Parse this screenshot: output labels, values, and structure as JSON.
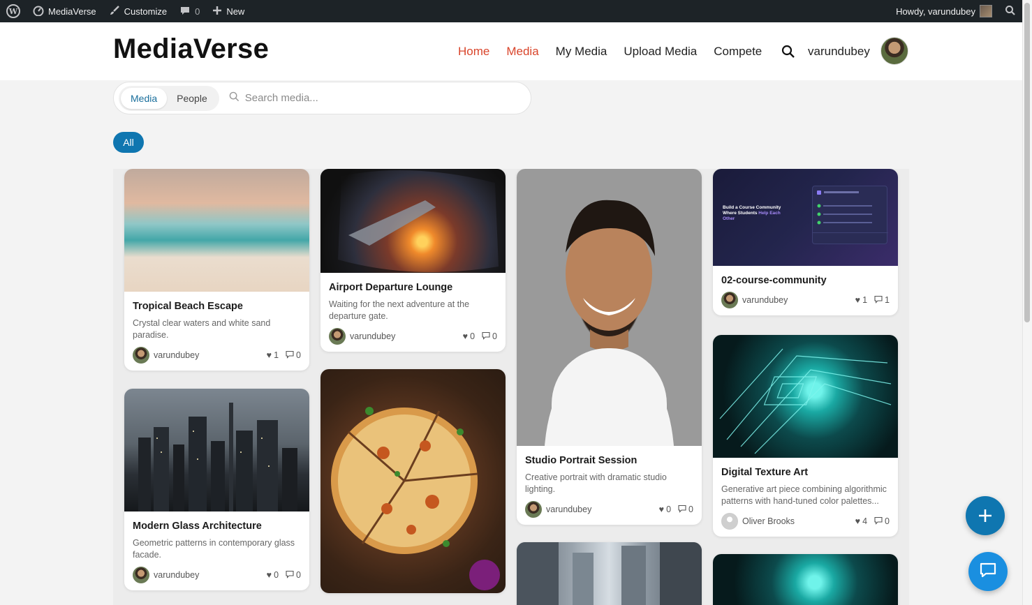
{
  "adminbar": {
    "site_name": "MediaVerse",
    "customize": "Customize",
    "comments_count": "0",
    "new_label": "New",
    "howdy": "Howdy, varundubey"
  },
  "header": {
    "site_title": "MediaVerse",
    "nav": [
      "Home",
      "Media",
      "My Media",
      "Upload Media",
      "Compete"
    ],
    "user_name": "varundubey"
  },
  "search": {
    "tab_media": "Media",
    "tab_people": "People",
    "placeholder": "Search media..."
  },
  "filter": {
    "all": "All"
  },
  "cards": [
    {
      "title": "Tropical Beach Escape",
      "desc": "Crystal clear waters and white sand paradise.",
      "author": "varundubey",
      "likes": "1",
      "comments": "0"
    },
    {
      "title": "Airport Departure Lounge",
      "desc": "Waiting for the next adventure at the departure gate.",
      "author": "varundubey",
      "likes": "0",
      "comments": "0"
    },
    {
      "title": "Studio Portrait Session",
      "desc": "Creative portrait with dramatic studio lighting.",
      "author": "varundubey",
      "likes": "0",
      "comments": "0"
    },
    {
      "title": "02-course-community",
      "desc": "",
      "author": "varundubey",
      "likes": "1",
      "comments": "1"
    },
    {
      "title": "Modern Glass Architecture",
      "desc": "Geometric patterns in contemporary glass facade.",
      "author": "varundubey",
      "likes": "0",
      "comments": "0"
    },
    {
      "title": "Digital Texture Art",
      "desc": "Generative art piece combining algorithmic patterns with hand-tuned color palettes...",
      "author": "Oliver Brooks",
      "likes": "4",
      "comments": "0"
    }
  ],
  "course_image": {
    "line1": "Build a Course Community",
    "line2a": "Where Students ",
    "line2b": "Help Each",
    "line3": "Other"
  },
  "icons": {
    "admin_logo": "wordpress-icon",
    "search": "search-icon",
    "like": "heart-icon",
    "comment": "comment-icon",
    "fab_add": "plus-icon",
    "fab_chat": "chat-icon"
  },
  "colors": {
    "accent": "#0f76b0",
    "nav_active": "#d9452b",
    "chat_fab": "#1a8fe0"
  }
}
